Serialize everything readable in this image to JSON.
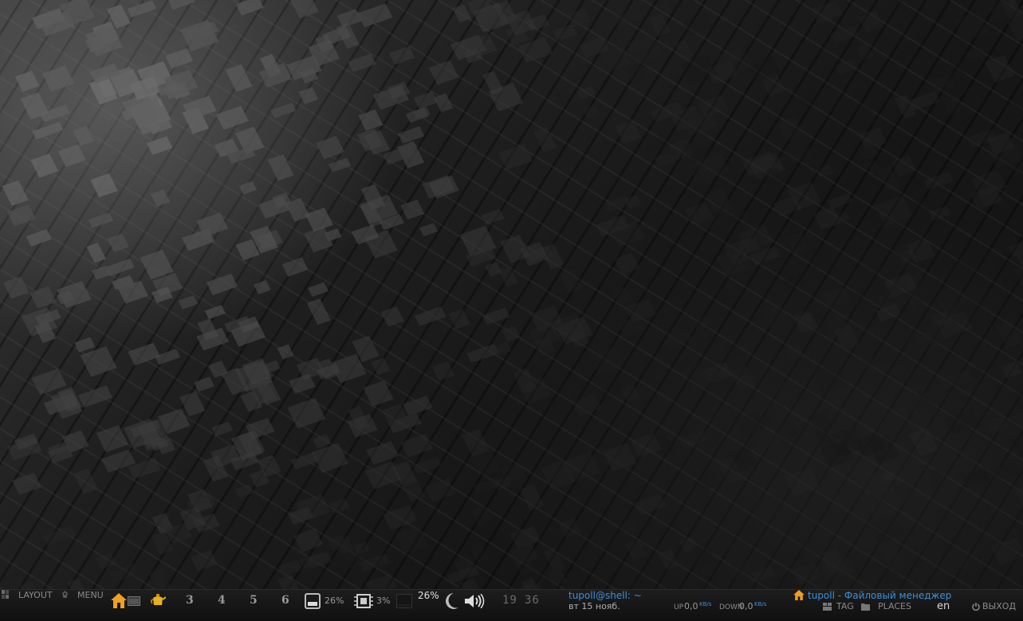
{
  "panel": {
    "layout_label": "LAYOUT",
    "menu_label": "MENU",
    "tags": [
      "3",
      "4",
      "5",
      "6"
    ],
    "memory_pct": "26%",
    "cpu_pct": "3%",
    "volume_level": "26%",
    "clock_hours": "19",
    "clock_minutes": "36",
    "terminal_title": "tupoll@shell: ~",
    "date": "вт 15 нояб.",
    "net": {
      "up_label": "UP",
      "up_value": "0,0",
      "up_unit": "KB/s",
      "down_label": "DOWN",
      "down_value": "0,0",
      "down_unit": "KB/s"
    },
    "file_manager_title": "tupoll - Файловый менеджер",
    "tag_label": "TAG",
    "places_label": "PLACES",
    "lang": "en",
    "exit_label": "ВЫХОД"
  },
  "colors": {
    "accent": "#3d8fd8",
    "home_icon": "#f0a020",
    "bar_bg": "#141414"
  },
  "icons": [
    "layout-icon",
    "menu-icon",
    "home-icon",
    "window-icon",
    "teapot-icon",
    "memory-icon",
    "cpu-icon",
    "moon-icon",
    "speaker-icon",
    "tag-icon",
    "places-icon",
    "power-icon"
  ]
}
